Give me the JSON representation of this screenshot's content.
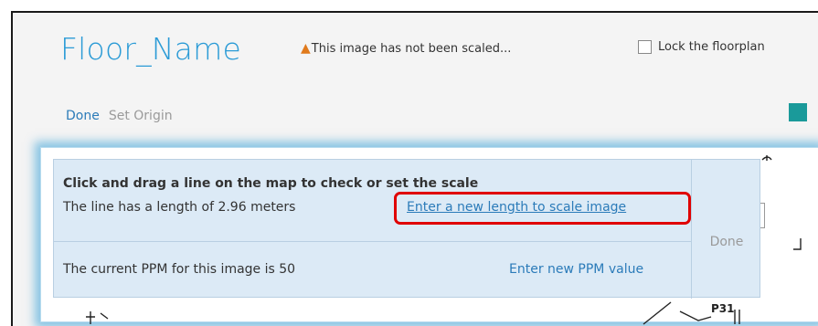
{
  "header": {
    "title": "Floor_Name",
    "warning_icon": "warning-triangle-icon",
    "warning_text": "This image has not been scaled...",
    "lock_label": "Lock the floorplan",
    "lock_checked": false
  },
  "toolbar": {
    "done_label": "Done",
    "set_origin_label": "Set Origin"
  },
  "map": {
    "labels": [
      "P31"
    ],
    "collapse_icon": "chevron-left-icon"
  },
  "scale_panel": {
    "title": "Click and drag a line on the map to check or set the scale",
    "length_text": "The line has a length of 2.96 meters",
    "scale_link": "Enter a new length to scale image",
    "ppm_text": "The current PPM for this image is 50",
    "ppm_link": "Enter new PPM value",
    "done_label": "Done"
  },
  "colors": {
    "title_blue": "#2b9bd6",
    "link_blue": "#2b7bb9",
    "panel_bg": "#dceaf6",
    "highlight_red": "#e00000",
    "warning_orange": "#e07a1c",
    "accent_teal": "#1a9a9a"
  }
}
